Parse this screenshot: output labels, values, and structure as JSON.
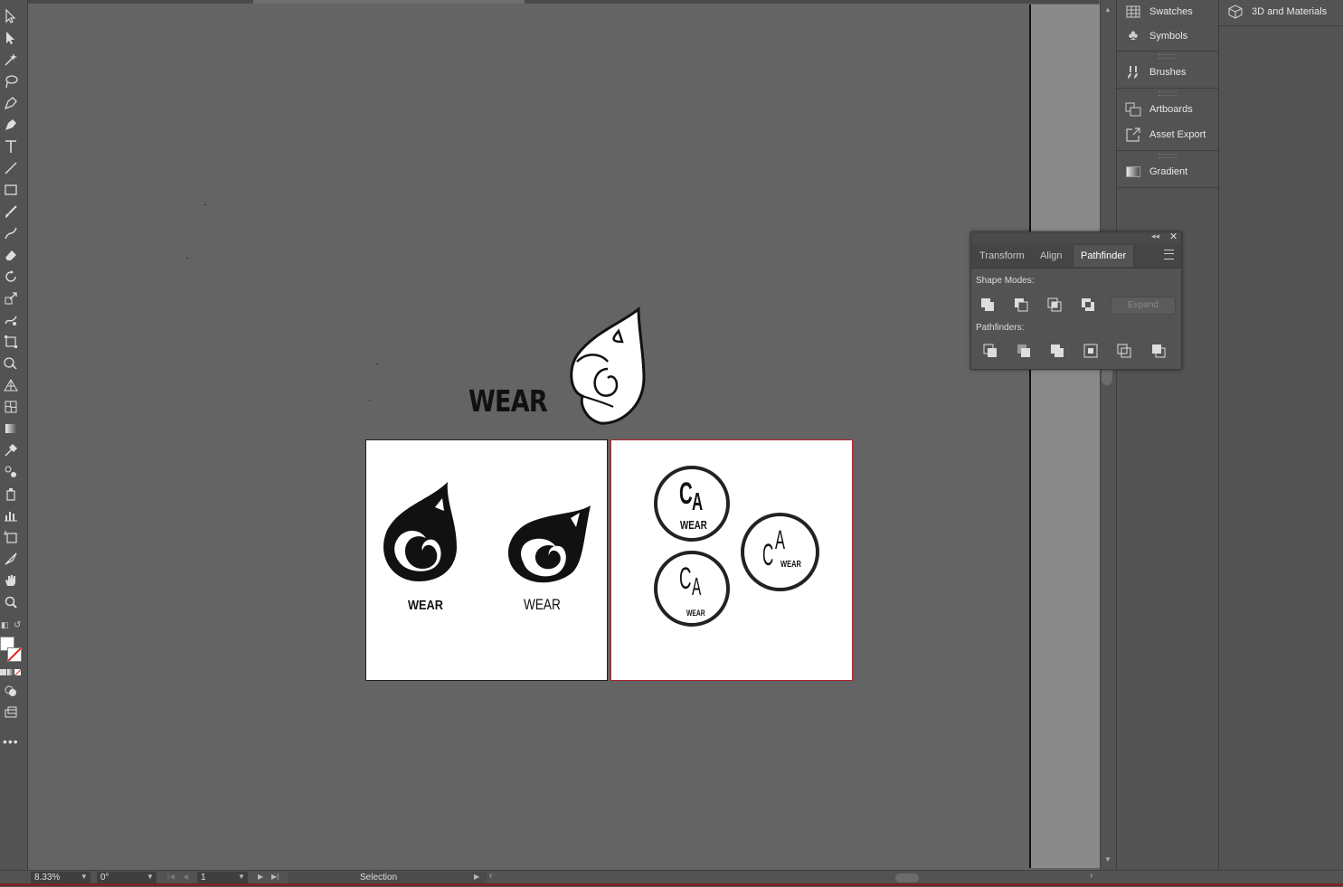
{
  "panels": {
    "dock": [
      {
        "label": "Swatches",
        "icon": "swatches-icon"
      },
      {
        "label": "Symbols",
        "icon": "symbols-icon"
      },
      {
        "label": "Brushes",
        "icon": "brushes-icon"
      },
      {
        "label": "Artboards",
        "icon": "artboards-icon"
      },
      {
        "label": "Asset Export",
        "icon": "asset-export-icon"
      },
      {
        "label": "Gradient",
        "icon": "gradient-icon"
      }
    ],
    "dock2": {
      "label": "3D and Materials",
      "icon": "cube-icon"
    }
  },
  "pathfinder": {
    "tabs": [
      "Transform",
      "Align",
      "Pathfinder"
    ],
    "active_tab": "Pathfinder",
    "shape_modes_label": "Shape Modes:",
    "pathfinders_label": "Pathfinders:",
    "expand_label": "Expand"
  },
  "artwork": {
    "wear_text": "WEAR",
    "logo1_text": "WEAR",
    "logo2_text": "WEAR",
    "badge_c": "C",
    "badge_a": "A",
    "badge_wear": "WEAR"
  },
  "status": {
    "zoom": "8.33%",
    "rotation": "0°",
    "artboard": "1",
    "tool": "Selection"
  },
  "colors": {
    "canvas": "#646464",
    "panel": "#535353",
    "artboard_border": "#b3242a"
  }
}
